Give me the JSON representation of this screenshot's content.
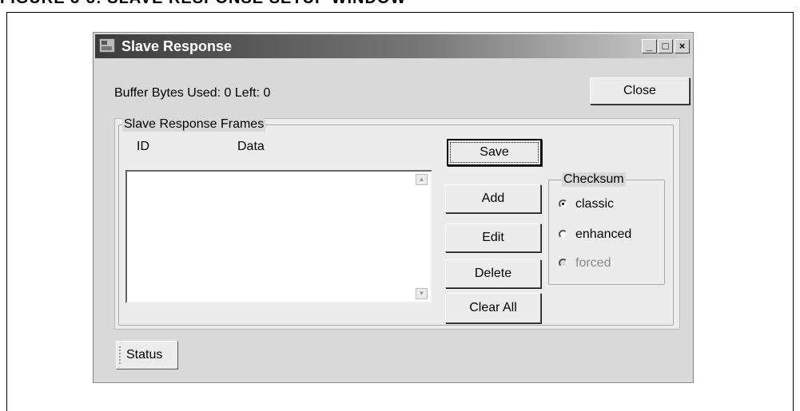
{
  "figure": {
    "caption": "FIGURE 3-3:        SLAVE RESPONSE SETUP WINDOW"
  },
  "window": {
    "title": "Slave Response",
    "minimize_glyph": "_",
    "maximize_glyph": "□",
    "close_glyph": "×",
    "icon": "app-window-icon"
  },
  "header": {
    "buffer_label": "Buffer Bytes Used: 0 Left: 0",
    "close_button": "Close"
  },
  "frames_group": {
    "legend": "Slave Response  Frames",
    "col_id": "ID",
    "col_data": "Data",
    "items": []
  },
  "actions": {
    "save": "Save",
    "add": "Add",
    "edit": "Edit",
    "delete": "Delete",
    "clear_all": "Clear All"
  },
  "checksum": {
    "legend": "Checksum",
    "options": [
      {
        "label": "classic",
        "selected": true,
        "enabled": true
      },
      {
        "label": "enhanced",
        "selected": false,
        "enabled": true
      },
      {
        "label": "forced",
        "selected": false,
        "enabled": false
      }
    ]
  },
  "status": {
    "tab_label": "Status"
  }
}
